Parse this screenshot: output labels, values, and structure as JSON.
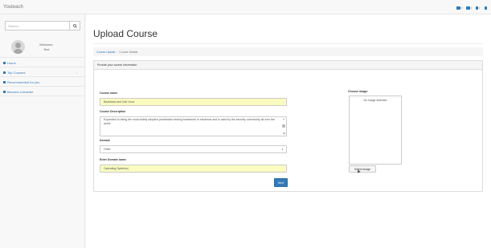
{
  "app": {
    "brand": "Youteach"
  },
  "navbar": {
    "icons": [
      {
        "name": "envelope-icon"
      },
      {
        "name": "tasks-icon"
      },
      {
        "name": "bell-icon"
      },
      {
        "name": "user-icon"
      }
    ],
    "accent": "#337ab7"
  },
  "sidebar": {
    "search": {
      "placeholder": "Search..."
    },
    "user": {
      "welcome": "Welcome",
      "name": "Test"
    },
    "items": [
      {
        "label": "Home",
        "icon": "home-icon"
      },
      {
        "label": "Top Courses",
        "icon": "bar-chart-icon",
        "has_arrow": true
      },
      {
        "label": "Recommended for you",
        "icon": "table-icon"
      },
      {
        "label": "Become a teacher",
        "icon": "edit-icon"
      }
    ]
  },
  "main": {
    "title": "Upload Course",
    "breadcrumb": {
      "items": [
        "Course Upload",
        "Course Details"
      ],
      "separator": "/"
    },
    "panel": {
      "heading": "Provide your course information",
      "course_name": {
        "label": "Course name",
        "value": "Backtrack and Kali Linux"
      },
      "course_description": {
        "label": "Course Description",
        "value": "Expanded to being the most widely adopted penetration testing framework in existence and is used by the security community all over the world."
      },
      "domain": {
        "label": "Domain",
        "selected": "Other"
      },
      "domain_name": {
        "label": "Enter Domain name",
        "value": "Operating Systems|"
      },
      "next_button": "Next",
      "image": {
        "label": "Choose image:",
        "status": "No image selected",
        "button": "Select image"
      }
    }
  },
  "colors": {
    "input_highlight": "#fafcc0",
    "primary": "#337ab7"
  }
}
